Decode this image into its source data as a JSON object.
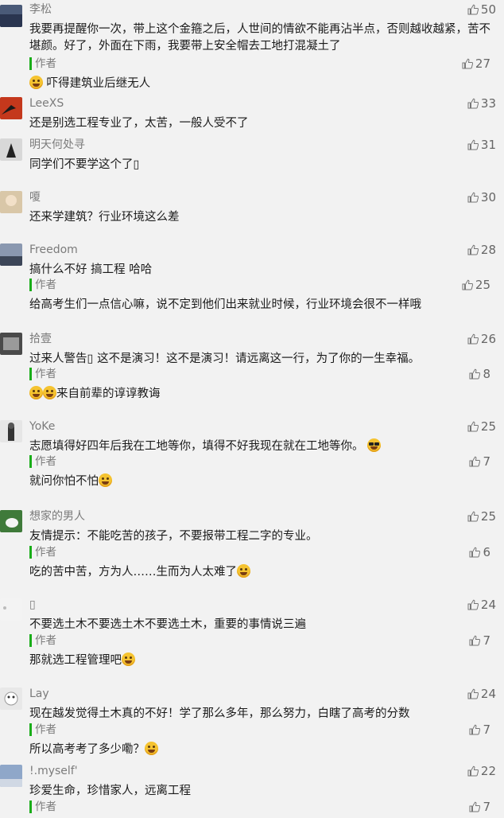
{
  "comments": [
    {
      "user": "李松",
      "likes": "50",
      "text": "我要再提醒你一次，带上这个金箍之后，人世间的情欲不能再沾半点，否则越收越紧，苦不堪颜。好了，外面在下雨，我要带上安全帽去工地打混凝土了",
      "avatar_color": "#4a5a78",
      "reply": {
        "label": "作者",
        "likes": "27",
        "text_before": "",
        "text": "吓得建筑业后继无人",
        "emoji_before": [
          "laugh-emoji"
        ],
        "emoji_after": []
      }
    },
    {
      "user": "LeeXS",
      "likes": "33",
      "text": "还是别选工程专业了，太苦，一般人受不了",
      "avatar_color": "#c4381c"
    },
    {
      "user": "明天何处寻",
      "likes": "31",
      "text": "同学们不要学这个了▯",
      "avatar_color": "#d8d8d8"
    },
    {
      "user": "嗄",
      "likes": "30",
      "text": "还来学建筑？行业环境这么差",
      "avatar_color": "#d9c7a8"
    },
    {
      "user": "Freedom",
      "likes": "28",
      "text": "搞什么不好  搞工程  哈哈",
      "avatar_color": "#6f7f98",
      "reply": {
        "label": "作者",
        "likes": "25",
        "text": "给高考生们一点信心嘛，说不定到他们出来就业时候，行业环境会很不一样哦",
        "emoji_before": [],
        "emoji_after": []
      }
    },
    {
      "user": "拾壹",
      "likes": "26",
      "text": "过来人警告▯ 这不是演习！这不是演习！请远离这一行，为了你的一生幸福。",
      "avatar_color": "#4a4a4a",
      "reply": {
        "label": "作者",
        "likes": "8",
        "text": "来自前辈的谆谆教诲",
        "emoji_before": [
          "laugh-emoji",
          "laugh-emoji"
        ],
        "emoji_after": []
      }
    },
    {
      "user": "YoKe",
      "likes": "25",
      "text": "志愿填得好四年后我在工地等你，填得不好我现在就在工地等你。",
      "avatar_color": "#e6e6e6",
      "text_emoji": "sunglasses-emoji",
      "reply": {
        "label": "作者",
        "likes": "7",
        "text": "就问你怕不怕",
        "emoji_before": [],
        "emoji_after": [
          "laugh-emoji"
        ]
      }
    },
    {
      "user": "想家的男人",
      "likes": "25",
      "text": "友情提示：不能吃苦的孩子，不要报带工程二字的专业。",
      "avatar_color": "#3f7a3a",
      "reply": {
        "label": "作者",
        "likes": "6",
        "text": "吃的苦中苦，方为人……生而为人太难了",
        "emoji_before": [],
        "emoji_after": [
          "sweat-emoji"
        ]
      }
    },
    {
      "user": "▯",
      "likes": "24",
      "text": "不要选土木不要选土木不要选土木，重要的事情说三遍",
      "avatar_color": "#f3f3f3",
      "reply": {
        "label": "作者",
        "likes": "7",
        "text": "那就选工程管理吧",
        "emoji_before": [],
        "emoji_after": [
          "smirk-emoji"
        ]
      }
    },
    {
      "user": "Lay",
      "likes": "24",
      "text": "现在越发觉得土木真的不好！学了那么多年，那么努力，白瞎了高考的分数",
      "avatar_color": "#e8e8e8",
      "reply": {
        "label": "作者",
        "likes": "7",
        "text": "所以高考考了多少嘞？",
        "emoji_before": [],
        "emoji_after": [
          "smirk-emoji"
        ]
      }
    },
    {
      "user": "!.myself'",
      "likes": "22",
      "text": "珍爱生命，珍惜家人，远离工程",
      "avatar_color": "#8fa7c9",
      "reply": {
        "label": "作者",
        "likes": "7",
        "text": "",
        "emoji_before": [],
        "emoji_after": []
      }
    }
  ]
}
